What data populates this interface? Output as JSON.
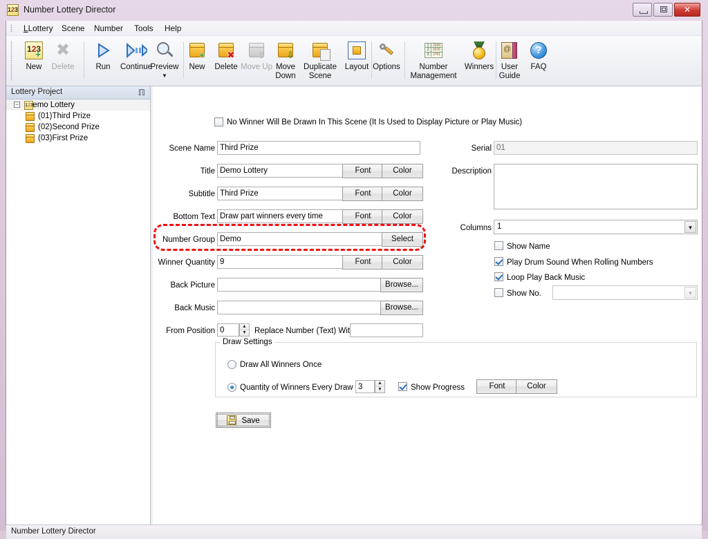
{
  "window": {
    "title": "Number Lottery Director",
    "icon": "app-icon",
    "controls": {
      "minimize": "Minimize",
      "maximize": "Restore",
      "close": "Close"
    }
  },
  "menubar": {
    "items": [
      {
        "label": "Lottery",
        "accel": "L"
      },
      {
        "label": "Scene",
        "accel": "S"
      },
      {
        "label": "Number",
        "accel": "N"
      },
      {
        "label": "Tools",
        "accel": "T"
      },
      {
        "label": "Help",
        "accel": "H"
      }
    ]
  },
  "toolbar": {
    "buttons": [
      {
        "label": "New",
        "icon": "new-project-icon",
        "disabled": false
      },
      {
        "label": "Delete",
        "icon": "delete-x-icon",
        "disabled": true
      },
      {
        "label": "Run",
        "icon": "play-icon",
        "disabled": false
      },
      {
        "label": "Continue",
        "icon": "continue-play-icon",
        "disabled": false
      },
      {
        "label": "Preview",
        "icon": "magnifier-icon",
        "disabled": false
      },
      {
        "label": "New",
        "icon": "new-scene-cube-icon",
        "disabled": false
      },
      {
        "label": "Delete",
        "icon": "delete-scene-cube-icon",
        "disabled": false
      },
      {
        "label": "Move Up",
        "icon": "move-up-cube-icon",
        "disabled": true
      },
      {
        "label": "Move Down",
        "icon": "move-down-cube-icon",
        "disabled": false
      },
      {
        "label": "Duplicate Scene",
        "icon": "duplicate-scene-icon",
        "disabled": false
      },
      {
        "label": "Layout",
        "icon": "layout-icon",
        "disabled": false
      },
      {
        "label": "Options",
        "icon": "wrench-icon",
        "disabled": false
      },
      {
        "label": "Number Management",
        "icon": "number-grid-icon",
        "disabled": false
      },
      {
        "label": "Winners",
        "icon": "medal-icon",
        "disabled": false
      },
      {
        "label": "User Guide",
        "icon": "book-icon",
        "disabled": false
      },
      {
        "label": "FAQ",
        "icon": "question-mark-icon",
        "disabled": false
      }
    ],
    "preview_dropdown_arrow": "▼",
    "overflow_arrow": "▼"
  },
  "sidebar": {
    "title": "Lottery Project",
    "pin_icon": "pin-icon",
    "tree": {
      "expander": "−",
      "root": {
        "label": "Demo Lottery",
        "icon": "lottery-project-icon"
      },
      "children": [
        {
          "label": "(01)Third Prize",
          "icon": "scene-cube-icon"
        },
        {
          "label": "(02)Second Prize",
          "icon": "scene-cube-icon"
        },
        {
          "label": "(03)First Prize",
          "icon": "scene-cube-icon"
        }
      ]
    }
  },
  "form": {
    "no_winner_checkbox": {
      "label": "No Winner Will Be Drawn In This Scene",
      "hint": "(It Is Used to Display Picture or Play Music)",
      "checked": false
    },
    "fields": {
      "scene_name": {
        "label": "Scene Name",
        "value": "Third Prize"
      },
      "title": {
        "label": "Title",
        "value": "Demo Lottery",
        "font_button": "Font",
        "color_button": "Color"
      },
      "subtitle": {
        "label": "Subtitle",
        "value": "Third Prize",
        "font_button": "Font",
        "color_button": "Color"
      },
      "bottom_text": {
        "label": "Bottom Text",
        "value": "Draw part winners every time",
        "font_button": "Font",
        "color_button": "Color"
      },
      "number_group": {
        "label": "Number Group",
        "value": "Demo",
        "select_button": "Select",
        "highlighted": true
      },
      "winner_quantity": {
        "label": "Winner Quantity",
        "value": "9",
        "font_button": "Font",
        "color_button": "Color"
      },
      "back_picture": {
        "label": "Back Picture",
        "value": "",
        "browse_button": "Browse..."
      },
      "back_music": {
        "label": "Back Music",
        "value": "",
        "browse_button": "Browse..."
      },
      "from_position": {
        "label": "From Position",
        "value": "0"
      },
      "replace_number": {
        "label": "Replace Number (Text) With",
        "value": ""
      }
    },
    "right": {
      "serial": {
        "label": "Serial",
        "value": "01",
        "disabled": true
      },
      "description": {
        "label": "Description",
        "value": ""
      },
      "columns": {
        "label": "Columns",
        "value": "1"
      },
      "checkboxes": [
        {
          "label": "Show Name",
          "checked": false
        },
        {
          "label": "Play Drum Sound When Rolling Numbers",
          "checked": true
        },
        {
          "label": "Loop Play Back Music",
          "checked": true
        },
        {
          "label": "Show No.",
          "checked": false
        }
      ],
      "show_no_combo": {
        "value": "",
        "disabled": true
      }
    },
    "draw_settings": {
      "title": "Draw Settings",
      "option_all": {
        "label": "Draw All Winners Once",
        "selected": false
      },
      "option_every_draw": {
        "label": "Quantity of Winners Every Draw",
        "selected": true,
        "value": "3"
      },
      "show_progress": {
        "label": "Show Progress",
        "checked": true
      },
      "font_button": "Font",
      "color_button": "Color"
    },
    "save_button": {
      "label": "Save",
      "icon": "save-floppy-icon"
    }
  },
  "statusbar": {
    "text": "Number Lottery Director"
  },
  "colors": {
    "window_chrome": "#dccadb",
    "accent_blue": "#3b7fd4",
    "highlight_red": "#ee1111",
    "cube_gold": "#eda41b",
    "close_red": "#cf3a32"
  }
}
